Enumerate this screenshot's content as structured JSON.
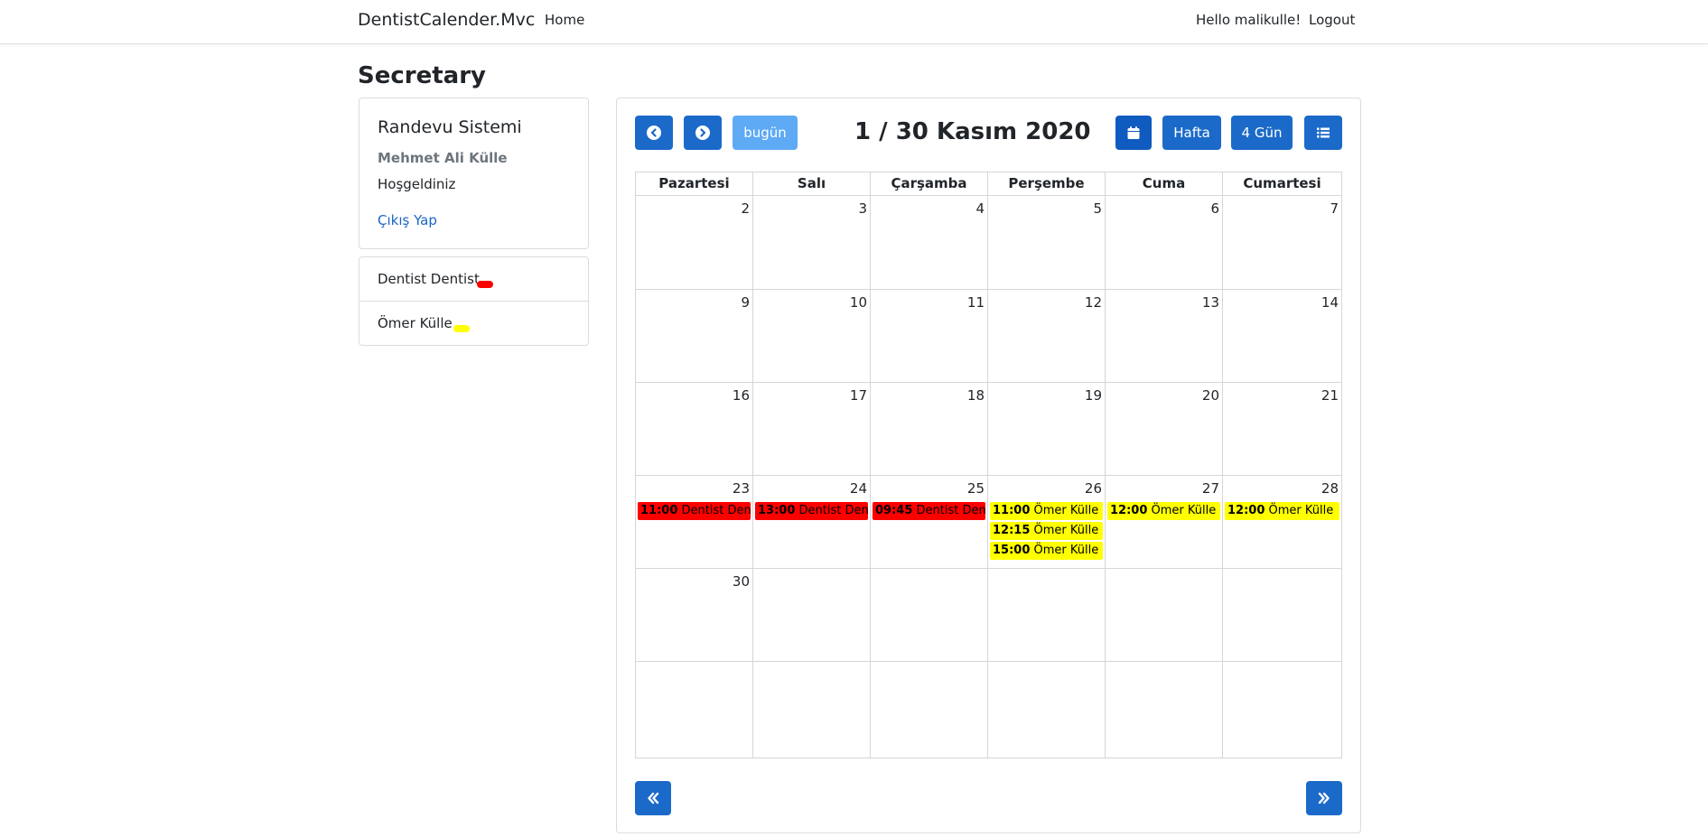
{
  "navbar": {
    "brand": "DentistCalender.Mvc",
    "home": "Home",
    "hello": "Hello malikulle!",
    "logout": "Logout"
  },
  "page": {
    "title": "Secretary"
  },
  "info_card": {
    "title": "Randevu Sistemi",
    "subtitle": "Mehmet Ali Külle",
    "welcome": "Hoşgeldiniz",
    "logout_link": "Çıkış Yap"
  },
  "dentists": [
    {
      "name": "Dentist Dentist",
      "color": "#ff0000"
    },
    {
      "name": "Ömer Külle",
      "color": "#ffff00"
    }
  ],
  "toolbar": {
    "prev_icon": "chevron-left-icon",
    "next_icon": "chevron-right-icon",
    "today": "bugün",
    "title": "1 / 30 Kasım 2020",
    "month_icon": "calendar-icon",
    "week": "Hafta",
    "four_day": "4 Gün",
    "list_icon": "list-icon"
  },
  "calendar": {
    "weekdays": [
      "Pazartesi",
      "Salı",
      "Çarşamba",
      "Perşembe",
      "Cuma",
      "Cumartesi"
    ],
    "weeks": [
      [
        "2",
        "3",
        "4",
        "5",
        "6",
        "7"
      ],
      [
        "9",
        "10",
        "11",
        "12",
        "13",
        "14"
      ],
      [
        "16",
        "17",
        "18",
        "19",
        "20",
        "21"
      ],
      [
        "23",
        "24",
        "25",
        "26",
        "27",
        "28"
      ],
      [
        "30",
        "",
        "",
        "",
        "",
        ""
      ],
      [
        "",
        "",
        "",
        "",
        "",
        ""
      ]
    ],
    "events": [
      {
        "day": "23",
        "time": "11:00",
        "title": "Dentist Dentist",
        "color": "#ff0000"
      },
      {
        "day": "24",
        "time": "13:00",
        "title": "Dentist Dentist",
        "color": "#ff0000"
      },
      {
        "day": "25",
        "time": "09:45",
        "title": "Dentist Dentist",
        "color": "#ff0000"
      },
      {
        "day": "26",
        "time": "11:00",
        "title": "Ömer Külle",
        "color": "#ffff00"
      },
      {
        "day": "26",
        "time": "12:15",
        "title": "Ömer Külle",
        "color": "#ffff00"
      },
      {
        "day": "26",
        "time": "15:00",
        "title": "Ömer Külle",
        "color": "#ffff00"
      },
      {
        "day": "27",
        "time": "12:00",
        "title": "Ömer Külle",
        "color": "#ffff00"
      },
      {
        "day": "28",
        "time": "12:00",
        "title": "Ömer Külle",
        "color": "#ffff00"
      }
    ]
  },
  "footer_nav": {
    "prev_year_icon": "double-chevron-left-icon",
    "next_year_icon": "double-chevron-right-icon"
  },
  "colors": {
    "primary": "#1b6ac9",
    "today_button": "#5eaaf5",
    "link": "#1a66c4"
  }
}
